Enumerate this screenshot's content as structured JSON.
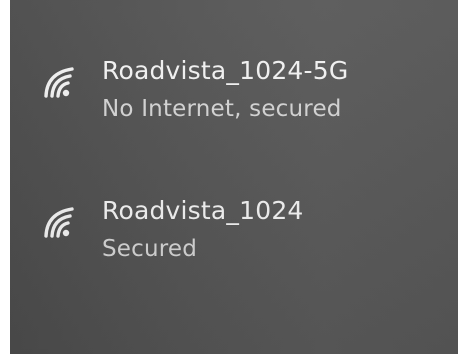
{
  "networks": [
    {
      "ssid": "Roadvista_1024-5G",
      "status": "No Internet, secured",
      "icon": "wifi-icon"
    },
    {
      "ssid": "Roadvista_1024",
      "status": "Secured",
      "icon": "wifi-icon"
    }
  ],
  "colors": {
    "panel_background": "#555555",
    "text_primary": "#f2f2f2",
    "text_secondary": "#d4d4d4"
  }
}
